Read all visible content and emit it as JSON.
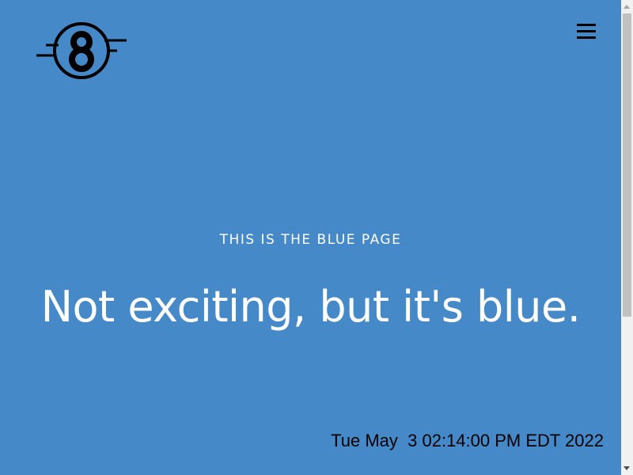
{
  "header": {
    "logo_text": "8",
    "menu_icon": "hamburger-menu-icon"
  },
  "hero": {
    "kicker": "THIS IS THE BLUE PAGE",
    "headline": "Not exciting, but it's blue."
  },
  "footer": {
    "timestamp": "Tue May  3 02:14:00 PM EDT 2022"
  },
  "colors": {
    "background": "#4689c8",
    "text": "#ffffff",
    "logo": "#000000"
  }
}
